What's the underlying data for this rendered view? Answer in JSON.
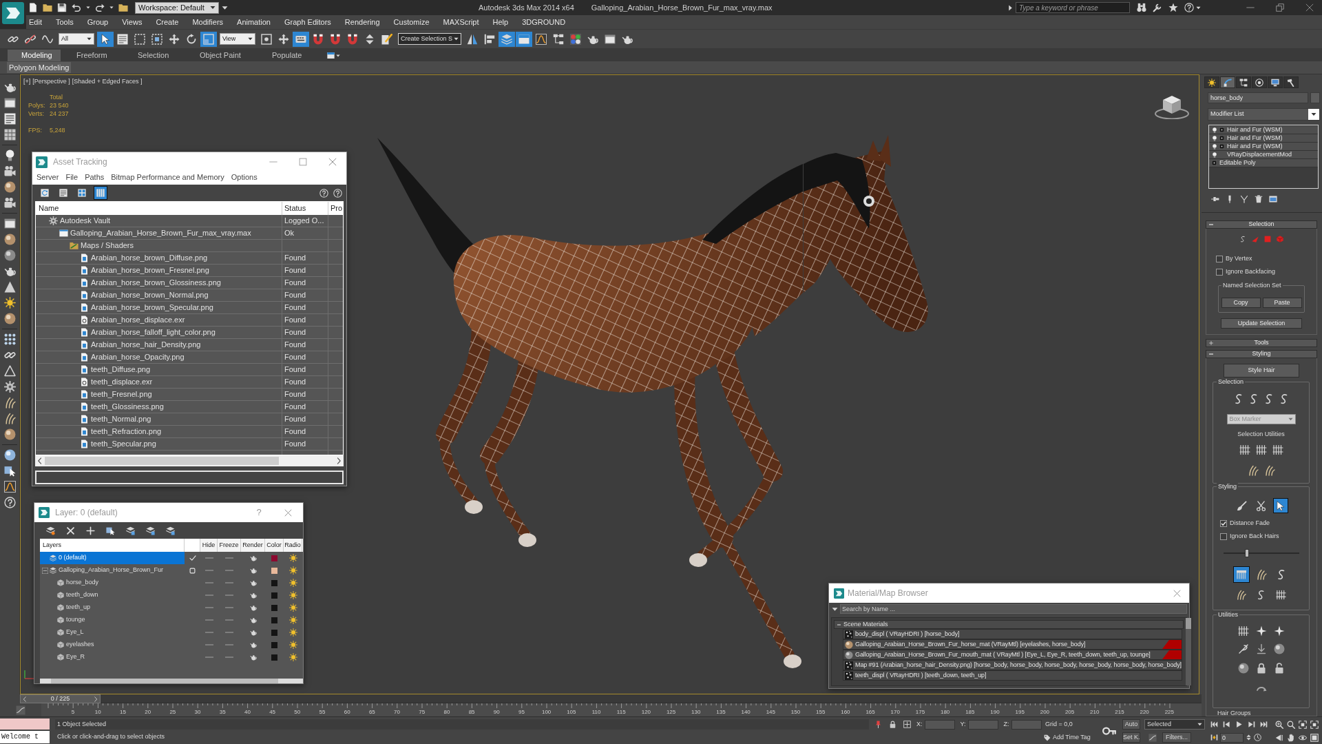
{
  "title_bar": {
    "workspace": "Workspace: Default",
    "app_title": "Autodesk 3ds Max 2014 x64",
    "file_name": "Galloping_Arabian_Horse_Brown_Fur_max_vray.max",
    "search": {
      "placeholder": "Type a keyword or phrase"
    }
  },
  "menu": [
    "Edit",
    "Tools",
    "Group",
    "Views",
    "Create",
    "Modifiers",
    "Animation",
    "Graph Editors",
    "Rendering",
    "Customize",
    "MAXScript",
    "Help",
    "3DGROUND"
  ],
  "toolbar": {
    "items": [
      {
        "kind": "tool",
        "selected": false
      },
      {
        "kind": "tool",
        "selected": false
      },
      {
        "kind": "tool",
        "selected": false
      },
      {
        "kind": "dropdown",
        "value": "All"
      },
      {
        "kind": "tool",
        "selected": true
      },
      {
        "kind": "tool",
        "selected": false
      },
      {
        "kind": "tool",
        "selected": false
      },
      {
        "kind": "tool",
        "selected": false
      },
      {
        "kind": "tool",
        "selected": false
      },
      {
        "kind": "tool",
        "selected": false
      },
      {
        "kind": "tool",
        "selected": true
      },
      {
        "kind": "dropdown",
        "value": "View"
      },
      {
        "kind": "tool",
        "selected": false
      },
      {
        "kind": "tool",
        "selected": false
      },
      {
        "kind": "tool",
        "selected": true
      },
      {
        "kind": "tool",
        "selected": false
      },
      {
        "kind": "tool",
        "selected": false
      },
      {
        "kind": "tool",
        "selected": false
      },
      {
        "kind": "tool",
        "selected": false
      },
      {
        "kind": "tool",
        "selected": false
      },
      {
        "kind": "dropdown",
        "value": "Create Selection S"
      },
      {
        "kind": "tool",
        "selected": false
      },
      {
        "kind": "tool",
        "selected": false
      },
      {
        "kind": "tool",
        "selected": true
      },
      {
        "kind": "tool",
        "selected": true
      },
      {
        "kind": "tool",
        "selected": false
      },
      {
        "kind": "tool",
        "selected": false
      },
      {
        "kind": "tool",
        "selected": false
      },
      {
        "kind": "tool",
        "selected": false
      },
      {
        "kind": "tool",
        "selected": false
      },
      {
        "kind": "tool",
        "selected": false
      }
    ]
  },
  "ribbon": {
    "tabs": [
      {
        "label": "Modeling",
        "selected": true
      },
      {
        "label": "Freeform",
        "selected": false
      },
      {
        "label": "Selection",
        "selected": false
      },
      {
        "label": "Object Paint",
        "selected": false
      },
      {
        "label": "Populate",
        "selected": false
      }
    ],
    "panel": "Polygon Modeling"
  },
  "viewport": {
    "labels": [
      "[+]",
      "[Perspective ]",
      "[Shaded + Edged Faces ]"
    ],
    "stats": {
      "heading": "Total",
      "rows": [
        {
          "label": "Polys:",
          "value": "23 540"
        },
        {
          "label": "Verts:",
          "value": "24 237"
        },
        {
          "label": "FPS:",
          "value": "5,248"
        }
      ]
    }
  },
  "asset_tracking": {
    "title": "Asset Tracking",
    "menu": [
      "Server",
      "File",
      "Paths",
      "Bitmap Performance and Memory",
      "Options"
    ],
    "toolbar": [
      {
        "selected": false
      },
      {
        "selected": false
      },
      {
        "selected": false
      },
      {
        "selected": true
      }
    ],
    "columns": [
      "Name",
      "Status",
      "Pro"
    ],
    "rows": [
      {
        "kind": "vault",
        "name": "Autodesk Vault",
        "status": "Logged O...",
        "selected": false,
        "children": [
          {
            "kind": "scene",
            "name": "Galloping_Arabian_Horse_Brown_Fur_max_vray.max",
            "status": "Ok",
            "selected": false,
            "children": [
              {
                "kind": "folder",
                "name": "Maps / Shaders",
                "selected": false,
                "children": [
                  {
                    "kind": "bitmap",
                    "name": "Arabian_horse_brown_Diffuse.png",
                    "status": "Found",
                    "selected": false
                  },
                  {
                    "kind": "bitmap",
                    "name": "Arabian_horse_brown_Fresnel.png",
                    "status": "Found",
                    "selected": false
                  },
                  {
                    "kind": "bitmap",
                    "name": "Arabian_horse_brown_Glossiness.png",
                    "status": "Found",
                    "selected": false
                  },
                  {
                    "kind": "bitmap",
                    "name": "Arabian_horse_brown_Normal.png",
                    "status": "Found",
                    "selected": false
                  },
                  {
                    "kind": "bitmap",
                    "name": "Arabian_horse_brown_Specular.png",
                    "status": "Found",
                    "selected": false
                  },
                  {
                    "kind": "exr",
                    "name": "Arabian_horse_displace.exr",
                    "status": "Found",
                    "selected": false
                  },
                  {
                    "kind": "bitmap",
                    "name": "Arabian_horse_falloff_light_color.png",
                    "status": "Found",
                    "selected": false
                  },
                  {
                    "kind": "bitmap",
                    "name": "Arabian_horse_hair_Density.png",
                    "status": "Found",
                    "selected": false
                  },
                  {
                    "kind": "bitmap",
                    "name": "Arabian_horse_Opacity.png",
                    "status": "Found",
                    "selected": false
                  },
                  {
                    "kind": "bitmap",
                    "name": "teeth_Diffuse.png",
                    "status": "Found",
                    "selected": false
                  },
                  {
                    "kind": "exr",
                    "name": "teeth_displace.exr",
                    "status": "Found",
                    "selected": false
                  },
                  {
                    "kind": "bitmap",
                    "name": "teeth_Fresnel.png",
                    "status": "Found",
                    "selected": false
                  },
                  {
                    "kind": "bitmap",
                    "name": "teeth_Glossiness.png",
                    "status": "Found",
                    "selected": false
                  },
                  {
                    "kind": "bitmap",
                    "name": "teeth_Normal.png",
                    "status": "Found",
                    "selected": false
                  },
                  {
                    "kind": "bitmap",
                    "name": "teeth_Refraction.png",
                    "status": "Found",
                    "selected": false
                  },
                  {
                    "kind": "bitmap",
                    "name": "teeth_Specular.png",
                    "status": "Found",
                    "selected": false
                  }
                ]
              }
            ]
          }
        ]
      }
    ]
  },
  "layer_manager": {
    "title": "Layer: 0 (default)",
    "help": "?",
    "columns": [
      "Layers",
      "Hide",
      "Freeze",
      "Render",
      "Color",
      "Radio"
    ],
    "layers": [
      {
        "name": "0 (default)",
        "selected": true,
        "current": true,
        "hidden": false,
        "frozen": false,
        "color": "#8c0a30"
      },
      {
        "name": "Galloping_Arabian_Horse_Brown_Fur",
        "selected": false,
        "current": false,
        "expanded": true,
        "hidden": false,
        "frozen": false,
        "color": "#e8b89a",
        "children": [
          {
            "name": "horse_body",
            "selected": false,
            "hidden": false,
            "frozen": false,
            "color": "#141414"
          },
          {
            "name": "teeth_down",
            "selected": false,
            "hidden": false,
            "frozen": false,
            "color": "#141414"
          },
          {
            "name": "teeth_up",
            "selected": false,
            "hidden": false,
            "frozen": false,
            "color": "#141414"
          },
          {
            "name": "tounge",
            "selected": false,
            "hidden": false,
            "frozen": false,
            "color": "#141414"
          },
          {
            "name": "Eye_L",
            "selected": false,
            "hidden": false,
            "frozen": false,
            "color": "#141414"
          },
          {
            "name": "eyelashes",
            "selected": false,
            "hidden": false,
            "frozen": false,
            "color": "#141414"
          },
          {
            "name": "Eye_R",
            "selected": false,
            "hidden": false,
            "frozen": false,
            "color": "#141414"
          }
        ]
      }
    ]
  },
  "material_browser": {
    "title": "Material/Map Browser",
    "search": {
      "placeholder": "Search by Name ..."
    },
    "group": {
      "title": "Scene Materials",
      "expanded": true,
      "items": [
        {
          "kind": "map",
          "text": "body_displ ( VRayHDRI ) [horse_body]",
          "flagged": false,
          "selected": false
        },
        {
          "kind": "material",
          "text": "Galloping_Arabian_Horse_Brown_Fur_horse_mat (VRayMtl) [eyelashes, horse_body]",
          "flagged": true,
          "selected": false
        },
        {
          "kind": "material",
          "text": "Galloping_Arabian_Horse_Brown_Fur_mouth_mat ( VRayMtl ) [Eye_L, Eye_R, teeth_down, teeth_up, tounge]",
          "flagged": true,
          "selected": false
        },
        {
          "kind": "map",
          "text": "Map #91 (Arabian_horse_hair_Density.png) [horse_body, horse_body, horse_body, horse_body, horse_body, horse_body]",
          "flagged": false,
          "selected": false
        },
        {
          "kind": "map",
          "text": "teeth_displ ( VRayHDRI ) [teeth_down, teeth_up]",
          "flagged": false,
          "selected": false
        }
      ]
    }
  },
  "command_panel": {
    "tabs": [
      {
        "kind": "create",
        "selected": false
      },
      {
        "kind": "modify",
        "selected": true
      },
      {
        "kind": "hierarchy",
        "selected": false
      },
      {
        "kind": "motion",
        "selected": false
      },
      {
        "kind": "display",
        "selected": false
      },
      {
        "kind": "utilities",
        "selected": false
      }
    ],
    "object_name": "horse_body",
    "modifier_list": "Modifier List",
    "stack": [
      {
        "kind": "modifier",
        "name": "Hair and Fur (WSM)",
        "expandable": true,
        "selected": false
      },
      {
        "kind": "modifier",
        "name": "Hair and Fur (WSM)",
        "expandable": true,
        "selected": false
      },
      {
        "kind": "modifier",
        "name": "Hair and Fur (WSM)",
        "expandable": true,
        "selected": false
      },
      {
        "kind": "modifier",
        "name": "VRayDisplacementMod",
        "expandable": false,
        "selected": false
      },
      {
        "kind": "base",
        "name": "Editable Poly",
        "expandable": true,
        "selected": false
      }
    ],
    "selection_rollout": {
      "title": "Selection",
      "expanded": true,
      "options": [
        {
          "label": "By Vertex",
          "checked": false
        },
        {
          "label": "Ignore Backfacing",
          "checked": false
        }
      ],
      "named_set": {
        "title": "Named Selection Set",
        "buttons": [
          "Copy",
          "Paste"
        ]
      },
      "update_button": "Update Selection"
    },
    "tools_rollout": {
      "title": "Tools",
      "expanded": false
    },
    "styling_rollout": {
      "title": "Styling",
      "expanded": true,
      "style_button": "Style Hair",
      "selection_group": {
        "title": "Selection",
        "dropdown": {
          "value": "Box Marker",
          "disabled": true
        },
        "utilities_label": "Selection Utilities"
      },
      "styling_group": {
        "title": "Styling",
        "tools": [
          {
            "selected": false
          },
          {
            "selected": false
          },
          {
            "selected": true
          }
        ],
        "options": [
          {
            "label": "Distance Fade",
            "checked": true
          },
          {
            "label": "Ignore Back Hairs",
            "checked": false
          }
        ],
        "slider": {
          "level": 0.3
        },
        "comb_tools": [
          {
            "selected": true
          },
          {
            "selected": false
          },
          {
            "selected": false
          },
          {
            "selected": false
          },
          {
            "selected": false
          },
          {
            "selected": false
          }
        ]
      },
      "utilities_group": {
        "title": "Utilities"
      },
      "next_group": "Hair Groups"
    }
  },
  "time_slider": {
    "label": "0 / 225",
    "level": 0
  },
  "timeline": {
    "labels": [
      "5",
      "10",
      "15",
      "20",
      "25",
      "30",
      "35",
      "40",
      "45",
      "50",
      "55",
      "60",
      "65",
      "70",
      "75",
      "80",
      "85",
      "90",
      "95",
      "100",
      "105",
      "110",
      "115",
      "120",
      "125",
      "130",
      "135",
      "140",
      "145",
      "150",
      "155",
      "160",
      "165",
      "170",
      "175",
      "180",
      "185",
      "190",
      "195",
      "200",
      "205",
      "210",
      "215",
      "220",
      "225"
    ]
  },
  "status_bar": {
    "listener_output": "Welcome t",
    "selection": "1 Object Selected",
    "prompt": "Click or click-and-drag to select objects",
    "coordinates": [
      "X:",
      "Y:",
      "Z:"
    ],
    "grid": "Grid = 0,0",
    "time_tag": "Add Time Tag"
  },
  "animation_controls": {
    "auto_key": "Auto",
    "key_filter": "Selected",
    "set_key": "Set K.",
    "filters": "Filters...",
    "frame": "0"
  }
}
